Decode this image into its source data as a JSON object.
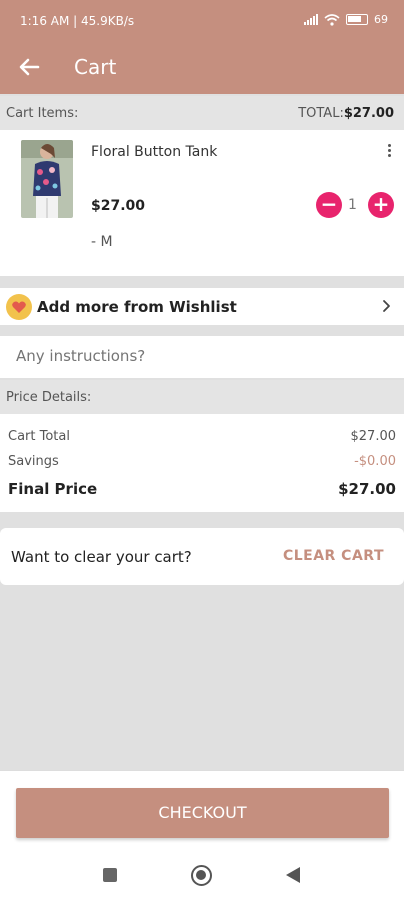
{
  "status": {
    "time": "1:16 AM | 45.9KB/s",
    "battery": "69"
  },
  "header": {
    "title": "Cart",
    "back_icon": "arrow-left-icon"
  },
  "cart_items_header": {
    "label": "Cart Items:",
    "total_label": "TOTAL:",
    "total_value": "$27.00"
  },
  "cart_item": {
    "name": "Floral Button Tank",
    "price": "$27.00",
    "size": "- M",
    "quantity": "1",
    "minus_label": "−",
    "plus_label": "+"
  },
  "wishlist": {
    "label": "Add more from Wishlist",
    "icon": "heart-icon"
  },
  "instructions": {
    "placeholder": "Any instructions?"
  },
  "price_details": {
    "header": "Price Details:",
    "rows": [
      {
        "label": "Cart Total",
        "value": "$27.00"
      },
      {
        "label": "Savings",
        "value": "-$0.00"
      }
    ],
    "final_label": "Final Price",
    "final_value": "$27.00"
  },
  "clear_cart": {
    "question": "Want to clear your cart?",
    "button": "CLEAR CART"
  },
  "checkout": {
    "button": "CHECKOUT"
  },
  "colors": {
    "brand": "#c58f7f",
    "accent": "#e8246d",
    "wishlist_badge": "#f2c24c"
  }
}
